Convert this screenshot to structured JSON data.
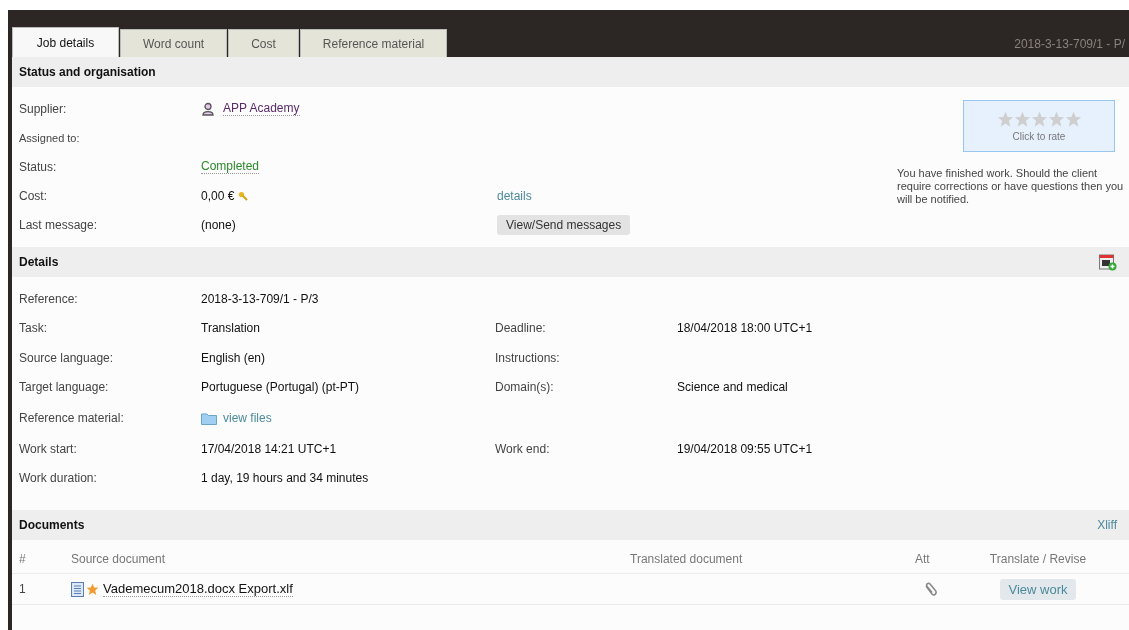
{
  "tabs": [
    {
      "label": "Job details",
      "selected": true
    },
    {
      "label": "Word count",
      "selected": false
    },
    {
      "label": "Cost",
      "selected": false
    },
    {
      "label": "Reference material",
      "selected": false
    }
  ],
  "header_reference": "2018-3-13-709/1 - P/",
  "status_section": {
    "title": "Status and organisation",
    "rows": [
      {
        "kind": "person",
        "label": "Supplier:",
        "value": "APP Academy"
      },
      {
        "kind": "small",
        "label": "Assigned to:"
      },
      {
        "kind": "status",
        "label": "Status:",
        "value": "Completed"
      },
      {
        "kind": "cost",
        "label": "Cost:",
        "value": "0,00 €",
        "link": "details"
      },
      {
        "kind": "message",
        "label": "Last message:",
        "value": "(none)",
        "button": "View/Send messages"
      }
    ],
    "rating": {
      "stars": 0,
      "caption": "Click to rate"
    },
    "note": "You have finished work. Should the client require corrections or have questions then you will be notified."
  },
  "details_section": {
    "title": "Details",
    "rows": [
      {
        "label": "Reference:",
        "value": "2018-3-13-709/1 - P/3"
      },
      {
        "label": "Task:",
        "value": "Translation",
        "label_2": "Deadline:",
        "value_2": "18/04/2018 18:00 UTC+1"
      },
      {
        "label": "Source language:",
        "value": "English (en)",
        "label_2": "Instructions:"
      },
      {
        "label": "Target language:",
        "value": "Portuguese (Portugal) (pt-PT)",
        "label_2": "Domain(s):",
        "value_2": "Science and medical"
      },
      {
        "label": "Reference material:",
        "kind": "files",
        "value": "view files"
      },
      {
        "label": "Work start:",
        "value": "17/04/2018 14:21 UTC+1",
        "label_2": "Work end:",
        "value_2": "19/04/2018 09:55 UTC+1"
      },
      {
        "label": "Work duration:",
        "value": "1 day, 19 hours and 34 minutes"
      }
    ]
  },
  "documents_section": {
    "title": "Documents",
    "link": "Xliff",
    "columns": [
      "#",
      "Source document",
      "Translated document",
      "Att",
      "Translate / Revise"
    ],
    "rows": [
      {
        "number": "1",
        "source": "Vademecum2018.docx Export.xlf",
        "starred": true,
        "button": "View work"
      }
    ]
  }
}
